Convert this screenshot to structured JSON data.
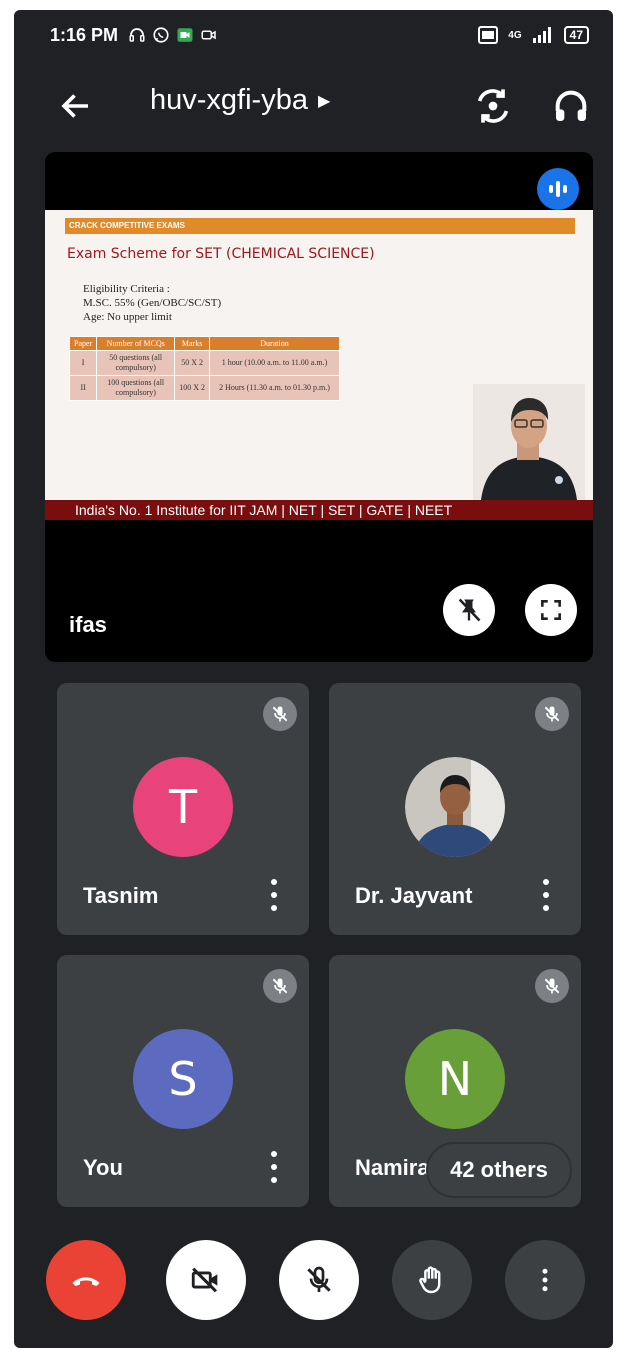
{
  "status_bar": {
    "time": "1:16 PM",
    "network": "4G",
    "battery": "47"
  },
  "call": {
    "code": "huv-xgfi-yba"
  },
  "presentation": {
    "band": "CRACK COMPETITIVE EXAMS",
    "heading": "Exam Scheme for SET (CHEMICAL SCIENCE)",
    "criteria": [
      "Eligibility Criteria :",
      "M.SC. 55% (Gen/OBC/SC/ST)",
      "Age:  No upper limit"
    ],
    "table": {
      "headers": [
        "Paper",
        "Number of MCQs",
        "Marks",
        "Duration"
      ],
      "rows": [
        [
          "I",
          "50 questions (all compulsory)",
          "50 X 2",
          "1 hour (10.00 a.m. to 11.00 a.m.)"
        ],
        [
          "II",
          "100 questions (all compulsory)",
          "100 X 2",
          "2 Hours (11.30 a.m. to 01.30 p.m.)"
        ]
      ]
    },
    "footer": "India's No. 1 Institute for IIT JAM | NET | SET | GATE | NEET",
    "presenter_name": "ifas"
  },
  "participants": [
    {
      "name": "Tasnim",
      "initial": "T",
      "color": "#e8437a"
    },
    {
      "name": "Dr. Jayvant",
      "initial": "",
      "color": "#6d7a8a"
    },
    {
      "name": "You",
      "initial": "S",
      "color": "#5c6bc0"
    },
    {
      "name": "Namira",
      "initial": "N",
      "color": "#689f38"
    }
  ],
  "others_label": "42 others"
}
